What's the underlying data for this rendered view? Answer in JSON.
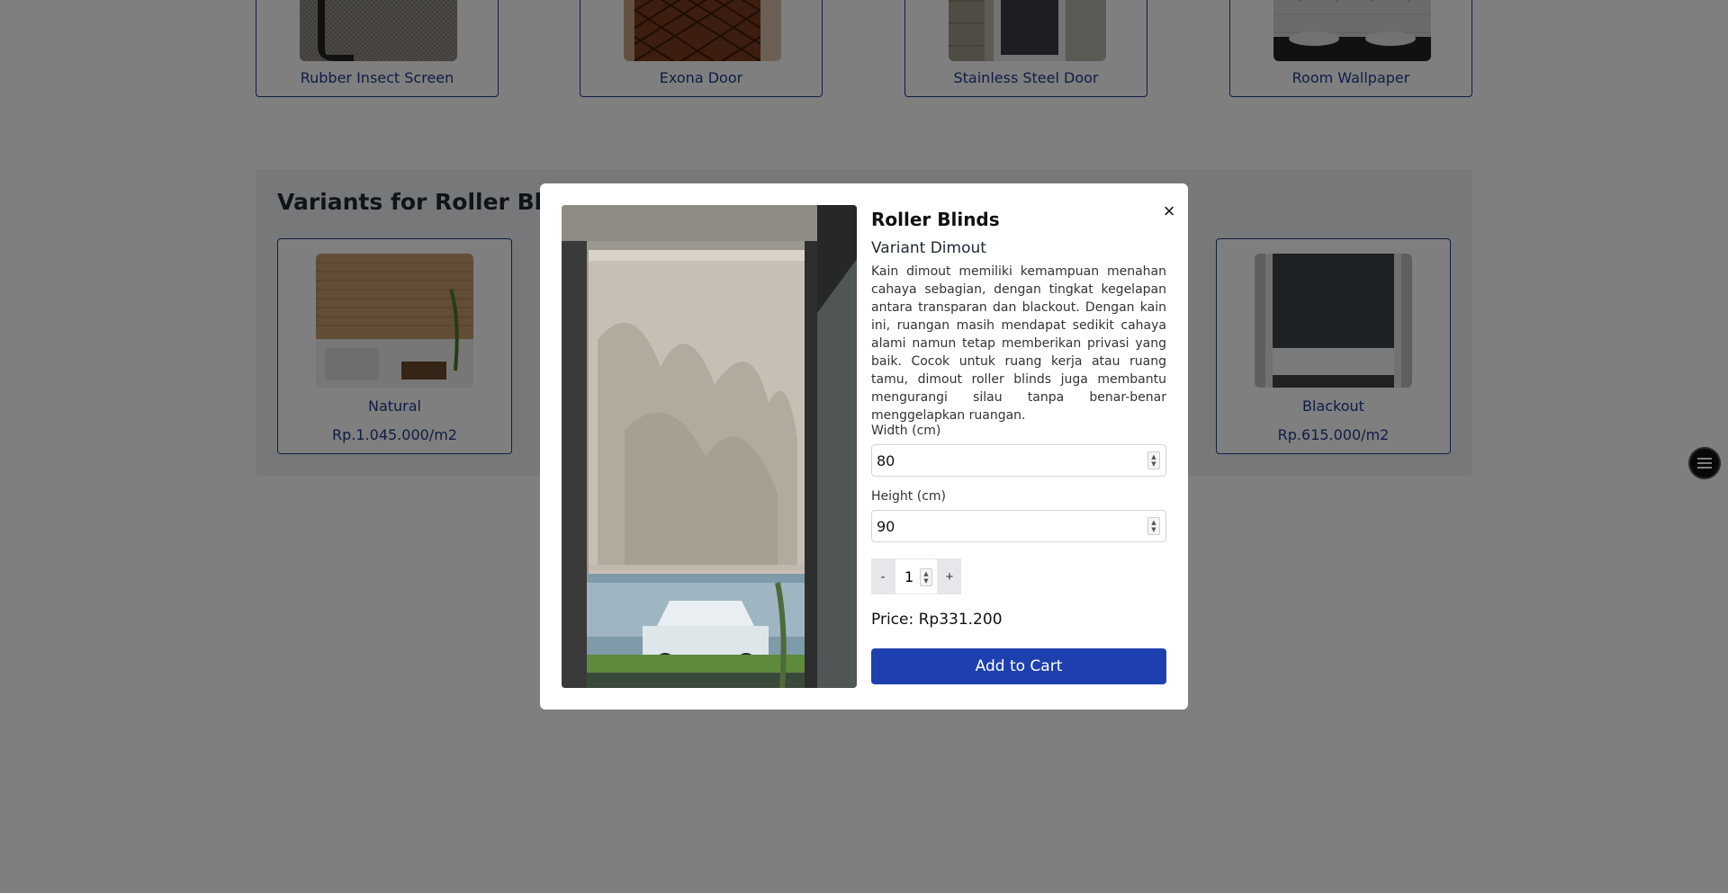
{
  "products": [
    {
      "name": "Rubber Insect Screen"
    },
    {
      "name": "Exona Door"
    },
    {
      "name": "Stainless Steel Door"
    },
    {
      "name": "Room Wallpaper"
    }
  ],
  "variants_section": {
    "title": "Variants for Roller Blinds",
    "variants": [
      {
        "name": "Natural",
        "price": "Rp.1.045.000/m2"
      },
      {
        "name": "Blackout",
        "price": "Rp.615.000/m2"
      }
    ]
  },
  "modal": {
    "close_icon": "×",
    "title": "Roller Blinds",
    "variant": "Variant Dimout",
    "description": "Kain dimout memiliki kemampuan menahan cahaya sebagian, dengan tingkat kegelapan antara transparan dan blackout. Dengan kain ini, ruangan masih mendapat sedikit cahaya alami namun tetap memberikan privasi yang baik. Cocok untuk ruang kerja atau ruang tamu, dimout roller blinds juga membantu mengurangi silau tanpa benar-benar menggelapkan ruangan.",
    "width_label": "Width (cm)",
    "width_value": "80",
    "height_label": "Height (cm)",
    "height_value": "90",
    "qty_minus": "-",
    "qty_value": "1",
    "qty_plus": "+",
    "price": "Price: Rp331.200",
    "add_button": "Add to Cart"
  },
  "colors": {
    "primary": "#1e40af",
    "border": "#1e3a8a"
  }
}
